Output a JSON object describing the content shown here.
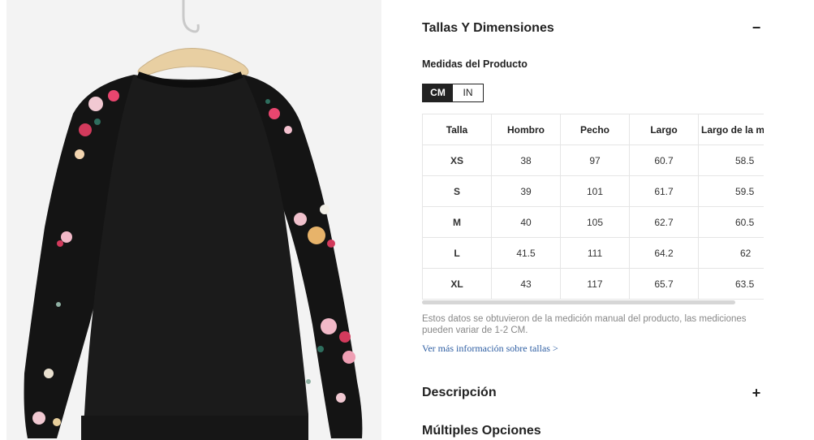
{
  "sections": {
    "sizes": {
      "title": "Tallas Y Dimensiones",
      "toggle": "−"
    },
    "description": {
      "title": "Descripción",
      "toggle": "+"
    },
    "options": {
      "title": "Múltiples Opciones"
    }
  },
  "measurements": {
    "subtitle": "Medidas del Producto",
    "units": [
      "CM",
      "IN"
    ],
    "selected_unit": "CM",
    "columns": [
      "Talla",
      "Hombro",
      "Pecho",
      "Largo",
      "Largo de la m"
    ],
    "rows": [
      [
        "XS",
        "38",
        "97",
        "60.7",
        "58.5"
      ],
      [
        "S",
        "39",
        "101",
        "61.7",
        "59.5"
      ],
      [
        "M",
        "40",
        "105",
        "62.7",
        "60.5"
      ],
      [
        "L",
        "41.5",
        "111",
        "64.2",
        "62"
      ],
      [
        "XL",
        "43",
        "117",
        "65.7",
        "63.5"
      ]
    ],
    "note": "Estos datos se obtuvieron de la medición manual del producto, las mediciones pueden variar de 1-2 CM.",
    "more_link": "Ver más información sobre tallas >"
  },
  "colors": {
    "accent": "#222222",
    "link": "#2f5fa3",
    "note": "#888888",
    "border": "#e5e5e5"
  },
  "product_image": {
    "description_icon": "floral-raglan-sweatshirt-back"
  }
}
